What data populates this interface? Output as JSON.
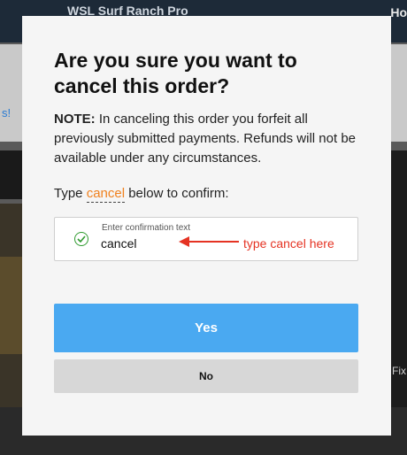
{
  "background": {
    "top_title": "WSL Surf Ranch Pro",
    "top_right": "Ho",
    "left_fragment": "s!",
    "right_fragment": "Fix"
  },
  "modal": {
    "title": "Are you sure you want to cancel this order?",
    "note_label": "NOTE:",
    "note_text": " In canceling this order you forfeit all previously submitted payments. Refunds will not be available under any circumstances.",
    "confirm_prefix": "Type ",
    "confirm_word": "cancel",
    "confirm_suffix": " below to confirm:",
    "field": {
      "label": "Enter confirmation text",
      "value": "cancel",
      "status_icon": "check-circle-icon"
    },
    "annotation": {
      "text": "type cancel here",
      "color": "#e53323"
    },
    "yes_label": "Yes",
    "no_label": "No"
  },
  "colors": {
    "accent": "#f0811e",
    "primary_button": "#4aa9f1",
    "secondary_button": "#d7d7d7",
    "success": "#2f9a2f"
  }
}
